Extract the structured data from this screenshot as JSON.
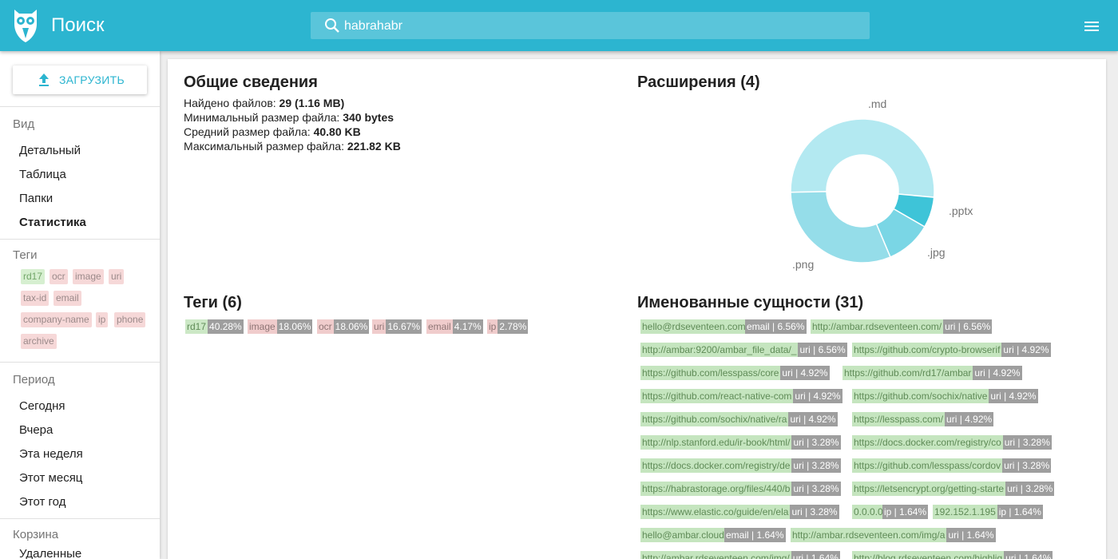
{
  "header": {
    "title": "Поиск",
    "search_value": "habrahabr",
    "logo_icon": "owl-logo-icon",
    "menu_icon": "hamburger-menu-icon",
    "color": "#2cb5d0"
  },
  "sidebar": {
    "upload_label": "ЗАГРУЗИТЬ",
    "view": {
      "heading": "Вид",
      "items": [
        {
          "label": "Детальный"
        },
        {
          "label": "Таблица"
        },
        {
          "label": "Папки"
        },
        {
          "label": "Статистика",
          "active": true
        }
      ]
    },
    "tags": {
      "heading": "Теги",
      "items": [
        {
          "label": "rd17",
          "color": "green"
        },
        {
          "label": "ocr",
          "color": "red"
        },
        {
          "label": "image",
          "color": "red"
        },
        {
          "label": "uri",
          "color": "red"
        },
        {
          "label": "tax-id",
          "color": "red"
        },
        {
          "label": "email",
          "color": "red"
        },
        {
          "label": "company-name",
          "color": "red"
        },
        {
          "label": "ip",
          "color": "red"
        },
        {
          "label": "phone",
          "color": "red"
        },
        {
          "label": "archive",
          "color": "red"
        }
      ]
    },
    "period": {
      "heading": "Период",
      "items": [
        {
          "label": "Сегодня"
        },
        {
          "label": "Вчера"
        },
        {
          "label": "Эта неделя"
        },
        {
          "label": "Этот месяц"
        },
        {
          "label": "Этот год"
        }
      ]
    },
    "trash": {
      "heading": "Корзина",
      "items": [
        {
          "label": "Удаленные"
        }
      ]
    }
  },
  "general": {
    "title": "Общие сведения",
    "lines": [
      {
        "label": "Найдено файлов: ",
        "value": "29 (1.16 MB)"
      },
      {
        "label": "Минимальный размер файла: ",
        "value": "340 bytes"
      },
      {
        "label": "Средний размер файла: ",
        "value": "40.80 KB"
      },
      {
        "label": "Максимальный размер файла: ",
        "value": "221.82 KB"
      }
    ]
  },
  "extensions": {
    "title": "Расширения (4)"
  },
  "chart_data": {
    "type": "pie",
    "style": "donut",
    "categories": [
      ".md",
      ".pptx",
      ".jpg",
      ".png"
    ],
    "values": [
      51.7,
      6.9,
      10.3,
      31.0
    ],
    "colors": [
      "#b3e9f1",
      "#3ec4d8",
      "#7ad6e5",
      "#95dde9"
    ],
    "title": "",
    "legend": "none"
  },
  "tag_stats": {
    "title": "Теги (6)",
    "items": [
      {
        "name": "rd17",
        "pct": "40.28%",
        "color": "green"
      },
      {
        "name": "image",
        "pct": "18.06%",
        "color": "red"
      },
      {
        "name": "ocr",
        "pct": "18.06%",
        "color": "red"
      },
      {
        "name": "uri",
        "pct": "16.67%",
        "color": "red"
      },
      {
        "name": "email",
        "pct": "4.17%",
        "color": "red"
      },
      {
        "name": "ip",
        "pct": "2.78%",
        "color": "red"
      }
    ]
  },
  "entities": {
    "title": "Именованные сущности (31)",
    "rows": [
      [
        {
          "text": "hello@rdseventeen.com",
          "meta": "email | 6.56%"
        },
        {
          "text": "http://ambar.rdseventeen.com/",
          "meta": "uri | 6.56%"
        }
      ],
      [
        {
          "text": "http://ambar:9200/ambar_file_data/_",
          "meta": "uri | 6.56%"
        },
        {
          "text": "https://github.com/crypto-browserif",
          "meta": "uri | 4.92%"
        }
      ],
      [
        {
          "text": "https://github.com/lesspass/core",
          "meta": "uri | 4.92%"
        },
        {
          "text": "https://github.com/rd17/ambar",
          "meta": "uri | 4.92%"
        }
      ],
      [
        {
          "text": "https://github.com/react-native-com",
          "meta": "uri | 4.92%"
        },
        {
          "text": "https://github.com/sochix/native",
          "meta": "uri | 4.92%"
        }
      ],
      [
        {
          "text": "https://github.com/sochix/native/ra",
          "meta": "uri | 4.92%"
        },
        {
          "text": "https://lesspass.com/",
          "meta": "uri | 4.92%"
        }
      ],
      [
        {
          "text": "http://nlp.stanford.edu/ir-book/html/",
          "meta": "uri | 3.28%"
        },
        {
          "text": "https://docs.docker.com/registry/co",
          "meta": "uri | 3.28%"
        }
      ],
      [
        {
          "text": "https://docs.docker.com/registry/de",
          "meta": "uri | 3.28%"
        },
        {
          "text": "https://github.com/lesspass/cordov",
          "meta": "uri | 3.28%"
        }
      ],
      [
        {
          "text": "https://habrastorage.org/files/440/b",
          "meta": "uri | 3.28%"
        },
        {
          "text": "https://letsencrypt.org/getting-starte",
          "meta": "uri | 3.28%"
        }
      ],
      [
        {
          "text": "https://www.elastic.co/guide/en/ela",
          "meta": "uri | 3.28%"
        },
        {
          "text": "0.0.0.0",
          "meta": "ip | 1.64%"
        },
        {
          "text": "192.152.1.195",
          "meta": "ip | 1.64%"
        }
      ],
      [
        {
          "text": "hello@ambar.cloud",
          "meta": "email | 1.64%"
        },
        {
          "text": "http://ambar.rdseventeen.com/img/a",
          "meta": "uri | 1.64%"
        }
      ],
      [
        {
          "text": "http://ambar.rdseventeen.com/img/",
          "meta": "uri | 1.64%"
        },
        {
          "text": "http://blog.rdseventeen.com/highlig",
          "meta": "uri | 1.64%"
        }
      ]
    ]
  }
}
